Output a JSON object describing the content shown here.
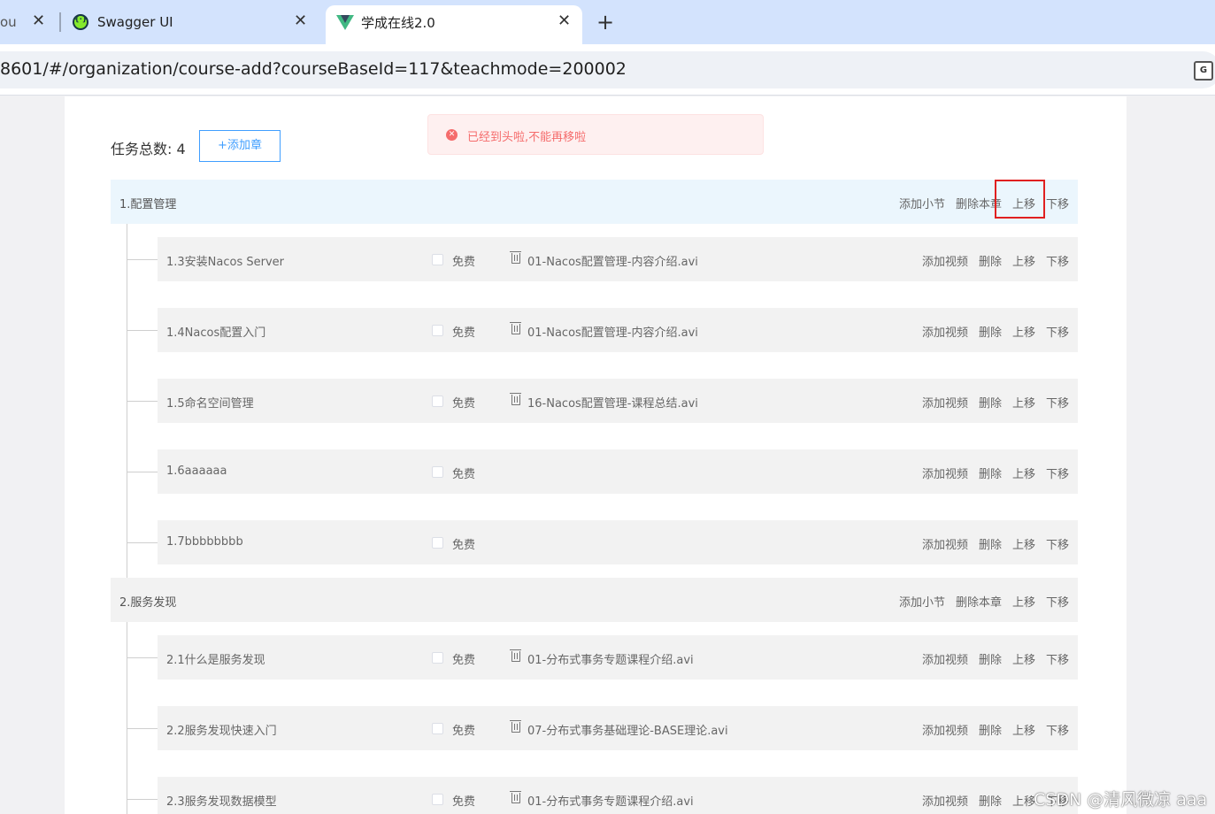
{
  "browser": {
    "tabs": [
      {
        "title": "ou"
      },
      {
        "title": "Swagger UI"
      },
      {
        "title": "学成在线2.0"
      }
    ],
    "url": "8601/#/organization/course-add?courseBaseId=117&teachmode=200002"
  },
  "toolbar": {
    "task_total_label": "任务总数: 4",
    "add_chapter_label": "+添加章"
  },
  "toast": {
    "message": "已经到头啦,不能再移啦",
    "type_color": "#f56c6c"
  },
  "actions": {
    "add_section": "添加小节",
    "delete_chapter": "删除本章",
    "add_video": "添加视频",
    "delete": "删除",
    "move_up": "上移",
    "move_down": "下移",
    "free": "免费"
  },
  "chapters": [
    {
      "title": "1.配置管理",
      "sections": [
        {
          "title": "1.3安装Nacos Server",
          "media": "01-Nacos配置管理-内容介绍.avi"
        },
        {
          "title": "1.4Nacos配置入门",
          "media": "01-Nacos配置管理-内容介绍.avi"
        },
        {
          "title": "1.5命名空间管理",
          "media": "16-Nacos配置管理-课程总结.avi"
        },
        {
          "title": "1.6aaaaaa",
          "media": ""
        },
        {
          "title": "1.7bbbbbbbb",
          "media": ""
        }
      ]
    },
    {
      "title": "2.服务发现",
      "sections": [
        {
          "title": "2.1什么是服务发现",
          "media": "01-分布式事务专题课程介绍.avi"
        },
        {
          "title": "2.2服务发现快速入门",
          "media": "07-分布式事务基础理论-BASE理论.avi"
        },
        {
          "title": "2.3服务发现数据模型",
          "media": "01-分布式事务专题课程介绍.avi"
        }
      ]
    }
  ],
  "watermark": "CSDN @清风微凉 aaa",
  "colors": {
    "accent": "#409eff",
    "highlight_bg": "#ebf6fd",
    "row_bg": "#f2f2f2",
    "annotation_red": "#e02020"
  }
}
